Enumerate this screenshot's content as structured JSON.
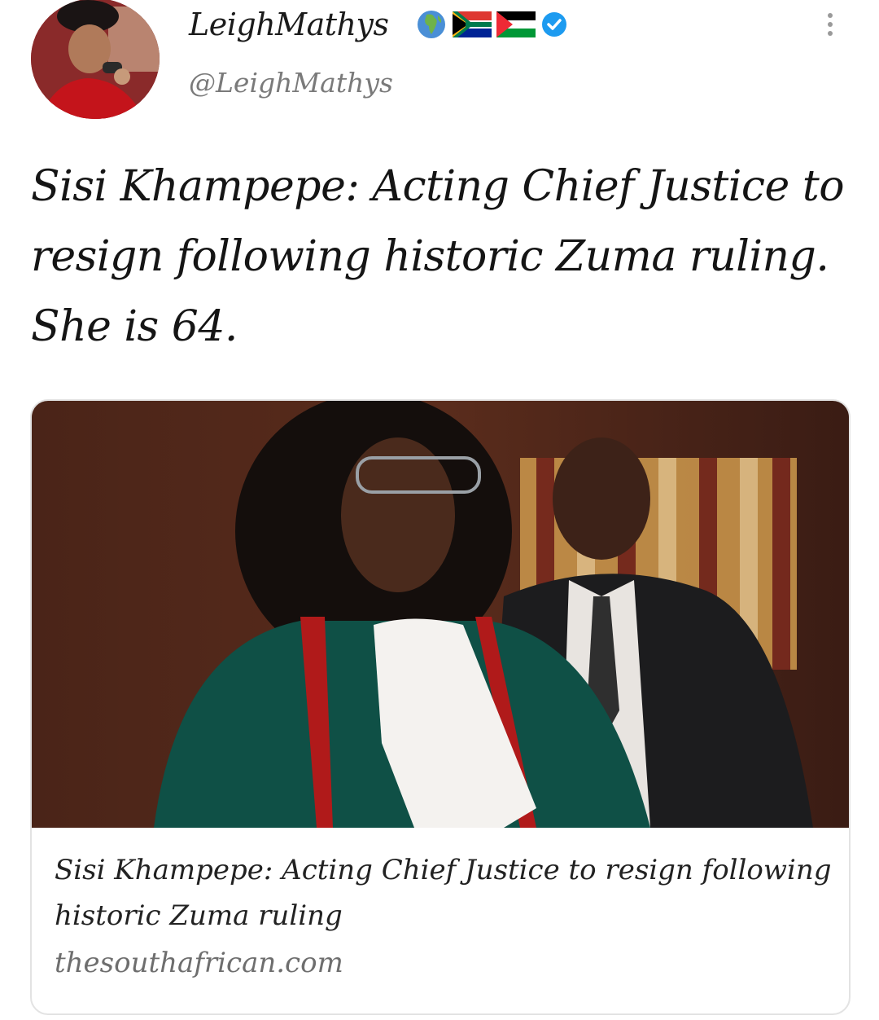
{
  "tweet": {
    "author": {
      "display_name": "LeighMathys",
      "handle": "@LeighMathys",
      "name_emojis": [
        "globe-africa-icon",
        "south-africa-flag-icon",
        "palestine-flag-icon"
      ],
      "verified": true
    },
    "text": "Sisi Khampepe: Acting Chief Justice to resign following historic Zuma ruling. She is 64.",
    "link_card": {
      "title": "Sisi Khampepe: Acting Chief Justice to resign following historic Zuma ruling",
      "domain": "thesouthafrican.com"
    }
  },
  "colors": {
    "verified_badge": "#1d9bf0",
    "handle_text": "#7a7a7a",
    "card_border": "#e3e3e3"
  }
}
